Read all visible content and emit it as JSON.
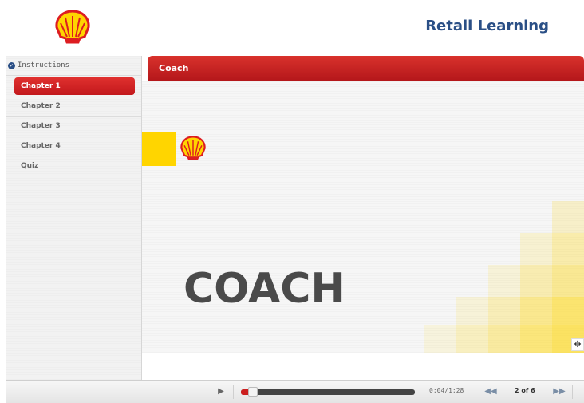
{
  "header": {
    "brand_title": "Retail Learning",
    "logo_icon": "shell-logo-icon"
  },
  "sidebar": {
    "items": [
      {
        "label": "Instructions",
        "completed": true,
        "active": false
      },
      {
        "label": "Chapter 1",
        "completed": false,
        "active": true
      },
      {
        "label": "Chapter 2",
        "completed": false,
        "active": false
      },
      {
        "label": "Chapter 3",
        "completed": false,
        "active": false
      },
      {
        "label": "Chapter 4",
        "completed": false,
        "active": false
      },
      {
        "label": "Quiz",
        "completed": false,
        "active": false
      }
    ]
  },
  "main": {
    "title": "Coach",
    "slide_word": "COACH"
  },
  "player": {
    "time": "0:04/1:28",
    "page": "2 of 6",
    "progress_fraction": 0.05,
    "icons": [
      "play-icon",
      "previous-icon",
      "next-icon",
      "expand-icon"
    ]
  },
  "colors": {
    "brand_red": "#c2181c",
    "brand_yellow": "#ffd500",
    "brand_blue": "#2a4f86"
  }
}
